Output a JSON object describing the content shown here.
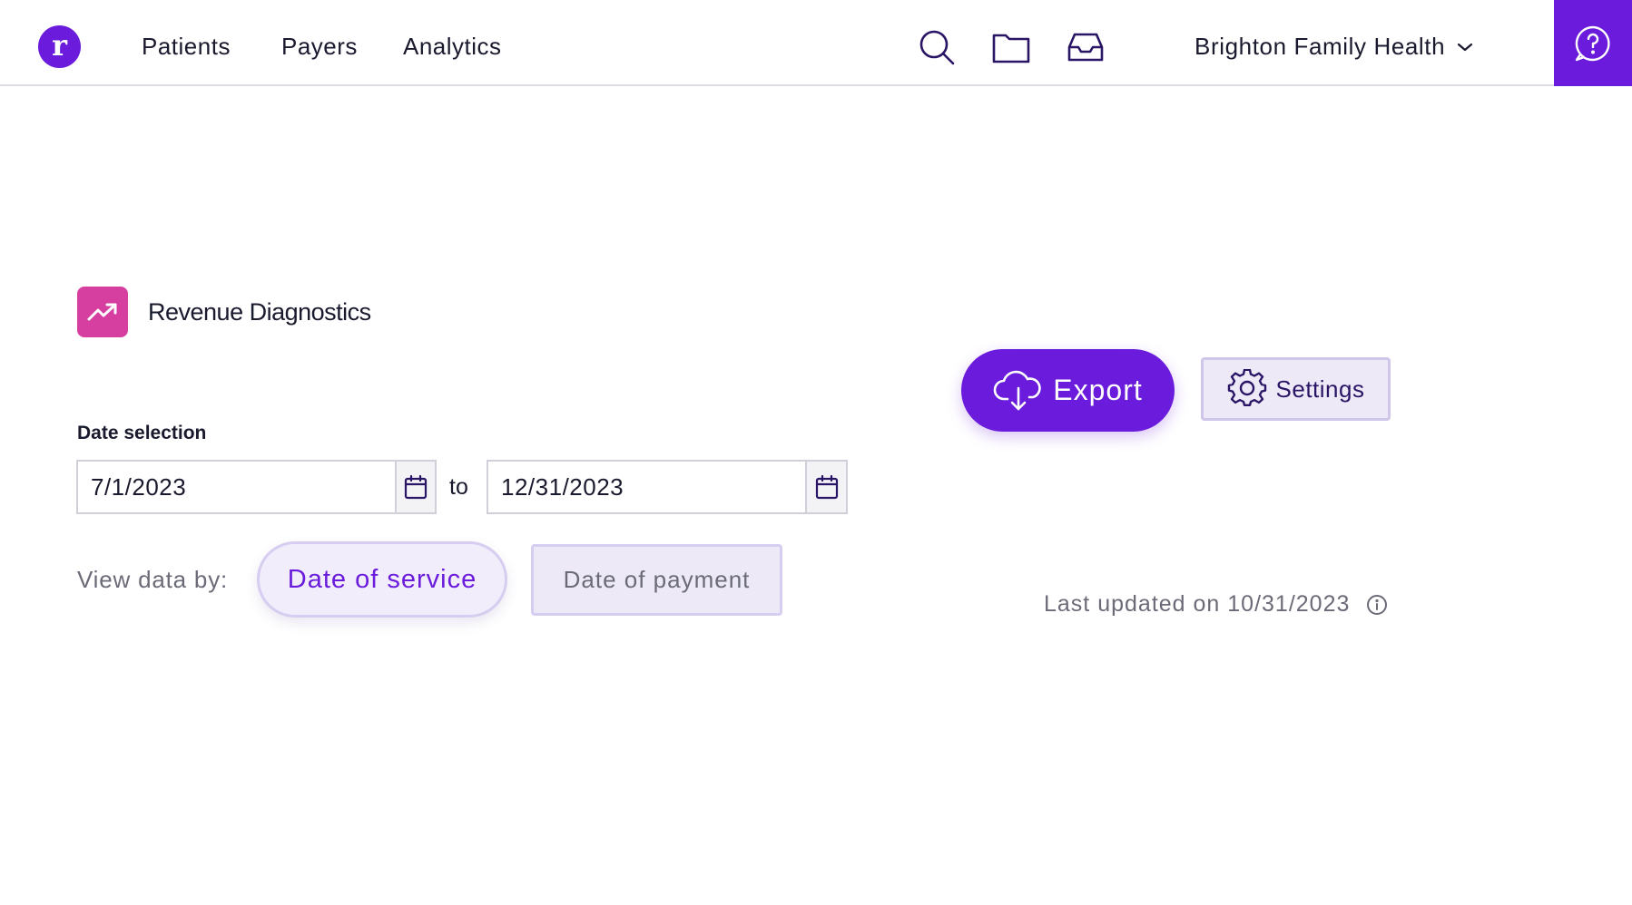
{
  "header": {
    "logo_letter": "r",
    "nav": {
      "patients": "Patients",
      "payers": "Payers",
      "analytics": "Analytics"
    },
    "organization": "Brighton Family Health"
  },
  "page": {
    "title": "Revenue Diagnostics"
  },
  "toolbar": {
    "export_label": "Export",
    "settings_label": "Settings"
  },
  "date_selection": {
    "label": "Date selection",
    "start": "7/1/2023",
    "to_label": "to",
    "end": "12/31/2023"
  },
  "view_by": {
    "label": "View data by:",
    "options": [
      "Date of service",
      "Date of payment"
    ],
    "selected": "Date of service"
  },
  "status": {
    "last_updated": "Last updated on 10/31/2023"
  },
  "colors": {
    "brand_purple": "#6a1bdb",
    "page_icon_pink": "#d63ea0"
  }
}
